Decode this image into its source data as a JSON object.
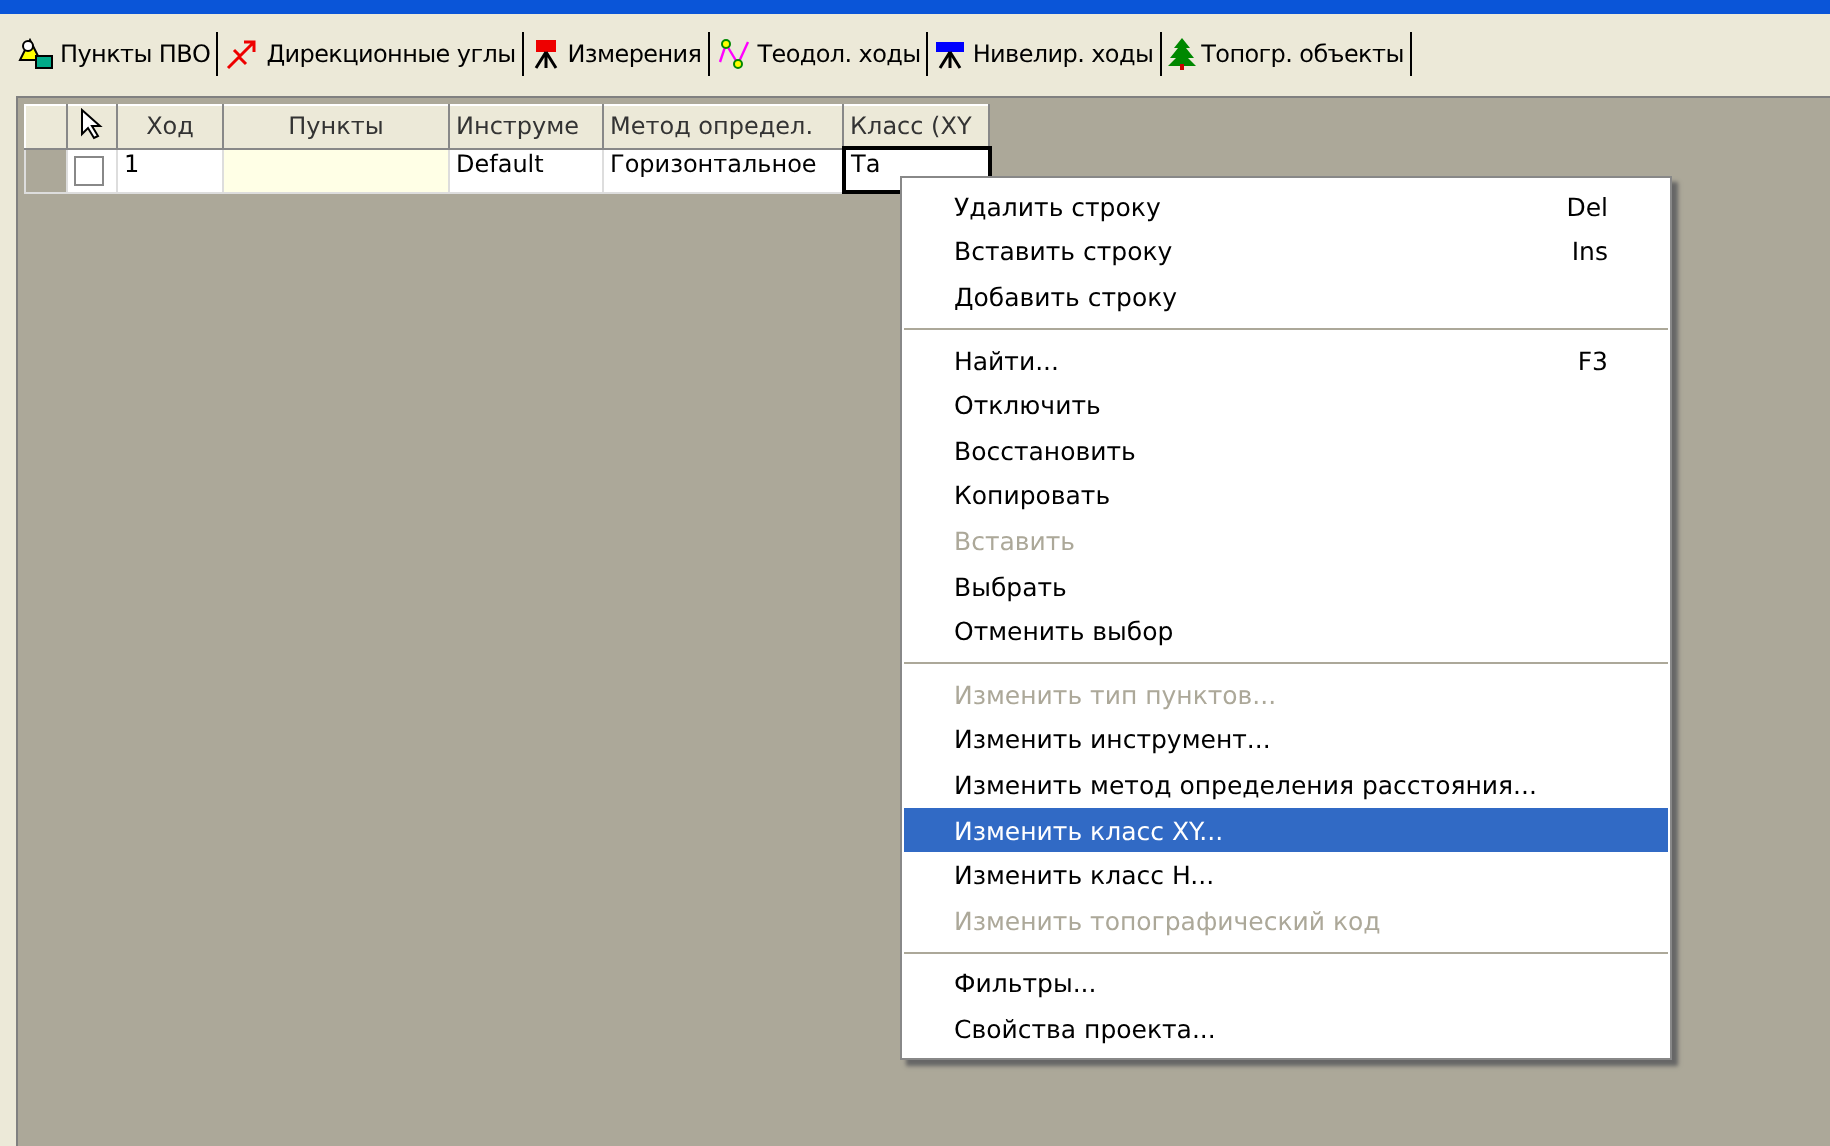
{
  "tabs": [
    {
      "label": "Пункты ПВО",
      "kind": "points"
    },
    {
      "label": "Дирекционные углы",
      "kind": "angles"
    },
    {
      "label": "Измерения",
      "kind": "measure"
    },
    {
      "label": "Теодол. ходы",
      "kind": "traverse"
    },
    {
      "label": "Нивелир. ходы",
      "kind": "level"
    },
    {
      "label": "Топогр. объекты",
      "kind": "tree"
    }
  ],
  "table": {
    "columns": [
      "Ход",
      "Пункты",
      "Инструме",
      "Метод определ.",
      "Класс (XY"
    ],
    "rows": [
      {
        "checked": false,
        "cells": [
          "1",
          "",
          "Default",
          "Горизонтальное",
          "Та"
        ]
      }
    ]
  },
  "context_menu": [
    {
      "kind": "item",
      "label": "Удалить строку",
      "shortcut": "Del",
      "disabled": false,
      "selected": false
    },
    {
      "kind": "item",
      "label": "Вставить строку",
      "shortcut": "Ins",
      "disabled": false,
      "selected": false
    },
    {
      "kind": "item",
      "label": "Добавить строку",
      "disabled": false,
      "selected": false
    },
    {
      "kind": "separator"
    },
    {
      "kind": "item",
      "label": "Найти...",
      "shortcut": "F3",
      "disabled": false,
      "selected": false
    },
    {
      "kind": "item",
      "label": "Отключить",
      "disabled": false,
      "selected": false
    },
    {
      "kind": "item",
      "label": "Восстановить",
      "disabled": false,
      "selected": false
    },
    {
      "kind": "item",
      "label": "Копировать",
      "disabled": false,
      "selected": false
    },
    {
      "kind": "item",
      "label": "Вставить",
      "disabled": true,
      "selected": false
    },
    {
      "kind": "item",
      "label": "Выбрать",
      "disabled": false,
      "selected": false
    },
    {
      "kind": "item",
      "label": "Отменить выбор",
      "disabled": false,
      "selected": false
    },
    {
      "kind": "separator"
    },
    {
      "kind": "item",
      "label": "Изменить тип пунктов...",
      "disabled": true,
      "selected": false
    },
    {
      "kind": "item",
      "label": "Изменить инструмент...",
      "disabled": false,
      "selected": false
    },
    {
      "kind": "item",
      "label": "Изменить метод определения расстояния...",
      "disabled": false,
      "selected": false
    },
    {
      "kind": "item",
      "label": "Изменить класс XY...",
      "disabled": false,
      "selected": true
    },
    {
      "kind": "item",
      "label": "Изменить класс H...",
      "disabled": false,
      "selected": false
    },
    {
      "kind": "item",
      "label": "Изменить топографический код",
      "disabled": true,
      "selected": false
    },
    {
      "kind": "separator"
    },
    {
      "kind": "item",
      "label": "Фильтры...",
      "disabled": false,
      "selected": false
    },
    {
      "kind": "item",
      "label": "Свойства проекта...",
      "disabled": false,
      "selected": false
    }
  ]
}
